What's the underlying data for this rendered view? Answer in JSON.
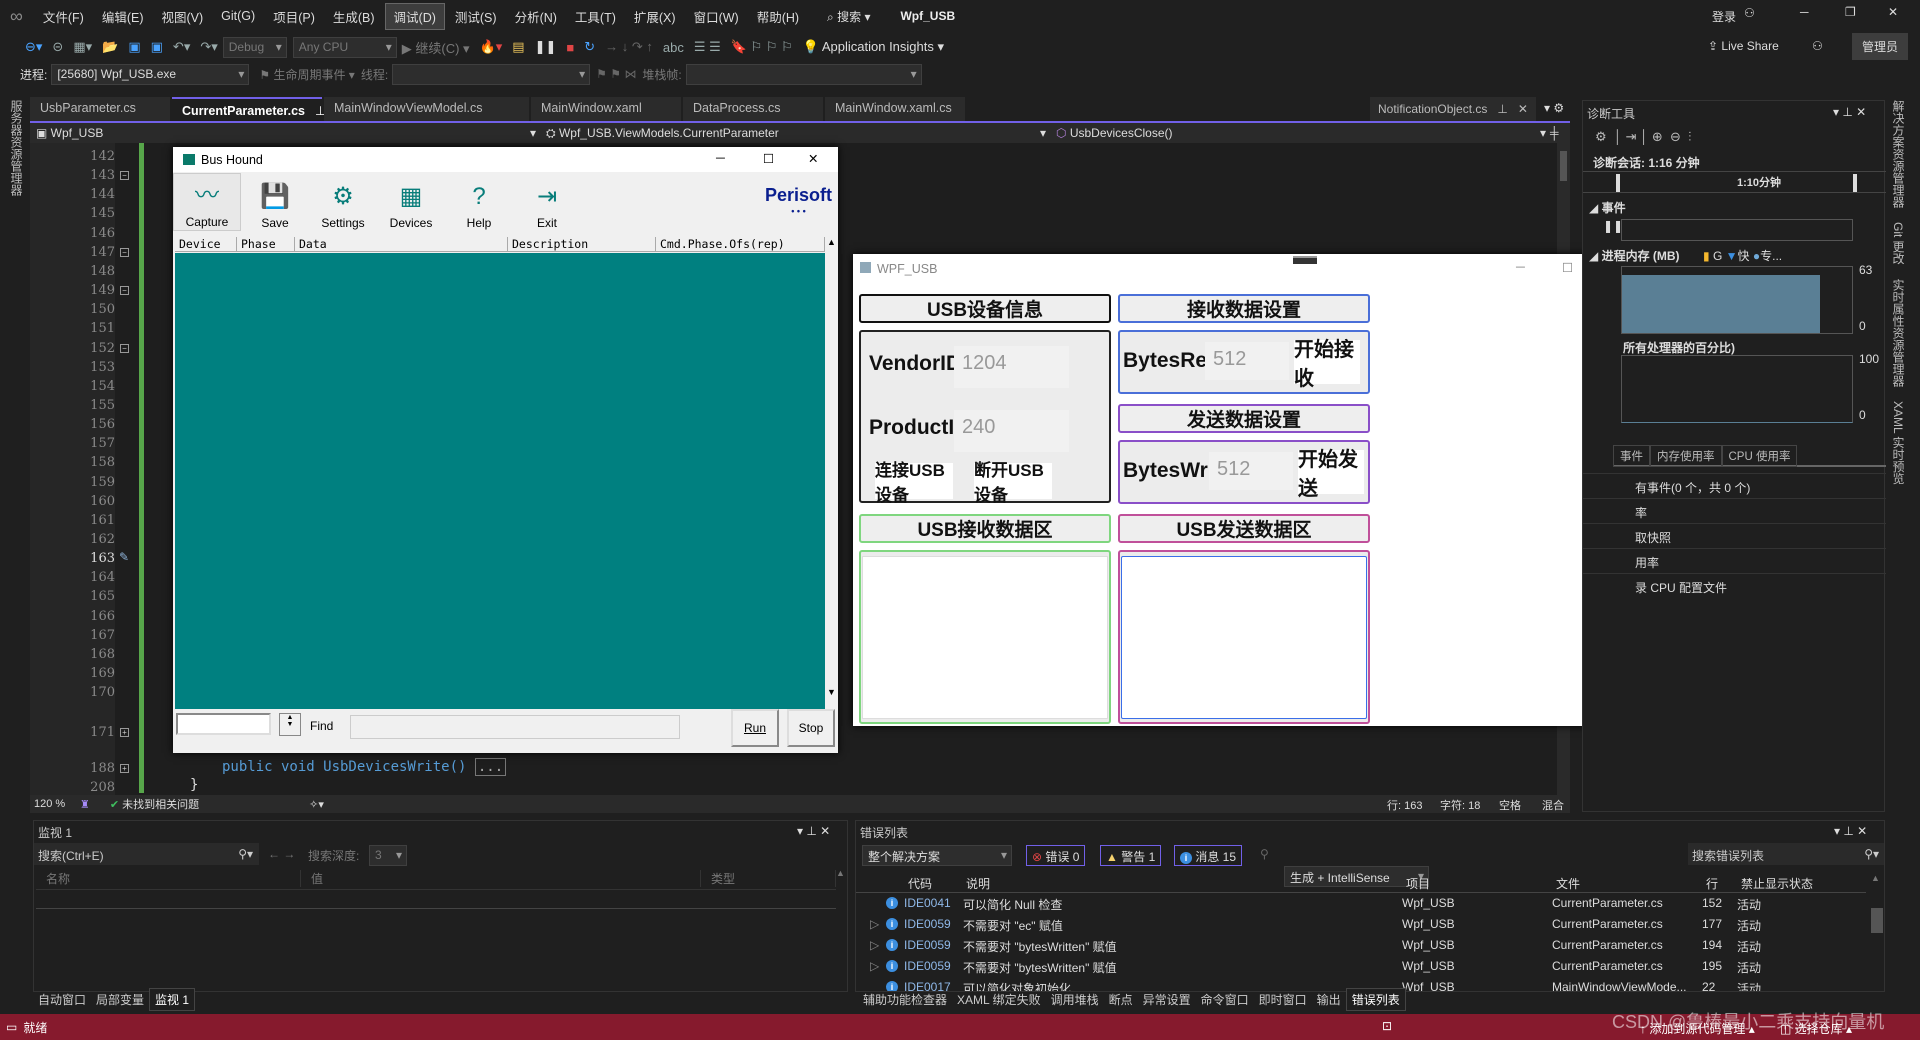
{
  "menubar": {
    "items": [
      "文件(F)",
      "编辑(E)",
      "视图(V)",
      "Git(G)",
      "项目(P)",
      "生成(B)",
      "调试(D)",
      "测试(S)",
      "分析(N)",
      "工具(T)",
      "扩展(X)",
      "窗口(W)",
      "帮助(H)"
    ],
    "active_index": 6,
    "search": "搜索",
    "solution_title": "Wpf_USB",
    "login": "登录"
  },
  "toolbar": {
    "config": "Debug",
    "platform": "Any CPU",
    "continue": "继续(C)",
    "app_insights": "Application Insights",
    "live_share": "Live Share",
    "admin": "管理员"
  },
  "toolbar2": {
    "process_label": "进程:",
    "process_value": "[25680] Wpf_USB.exe",
    "lifecycle": "生命周期事件",
    "thread_label": "线程:",
    "stackframe_label": "堆栈帧:"
  },
  "tabs": [
    "UsbParameter.cs",
    "CurrentParameter.cs",
    "MainWindowViewModel.cs",
    "MainWindow.xaml",
    "DataProcess.cs",
    "MainWindow.xaml.cs"
  ],
  "active_tab": 1,
  "pinned_tab": "NotificationObject.cs",
  "navbar": {
    "project": "Wpf_USB",
    "class": "Wpf_USB.ViewModels.CurrentParameter",
    "member": "UsbDevicesClose()"
  },
  "left_strip": "服务器资源管理器",
  "editor": {
    "line_numbers": [
      "142",
      "143",
      "144",
      "145",
      "146",
      "147",
      "148",
      "149",
      "150",
      "151",
      "152",
      "153",
      "154",
      "155",
      "156",
      "157",
      "158",
      "159",
      "160",
      "161",
      "162",
      "163",
      "164",
      "165",
      "166",
      "167",
      "168",
      "169",
      "170"
    ],
    "folded_lines": [
      "171",
      "188",
      "208"
    ],
    "current_line": "163",
    "code_line": "public void UsbDevicesWrite()",
    "collapsed": "...",
    "closing_brace": "}"
  },
  "editor_status": {
    "zoom": "120 %",
    "issues": "未找到相关问题",
    "line": "行: 163",
    "char": "字符: 18",
    "spaces": "空格",
    "eol": "混合"
  },
  "bushound": {
    "title": "Bus Hound",
    "tools": [
      "Capture",
      "Save",
      "Settings",
      "Devices",
      "Help",
      "Exit"
    ],
    "brand": "Perisoft",
    "columns": [
      "Device",
      "Phase",
      "Data",
      "Description",
      "Cmd.Phase.Ofs(rep)"
    ],
    "find_label": "Find",
    "run": "Run",
    "stop": "Stop",
    "capture_bg": "#008080"
  },
  "wpf": {
    "title": "WPF_USB",
    "device_header": "USB设备信息",
    "vendor_label": "VendorID:",
    "vendor_value": "1204",
    "product_label": "ProductID:",
    "product_value": "240",
    "connect": "连接USB设备",
    "disconnect": "断开USB设备",
    "recv_settings": "接收数据设置",
    "bytes_read_label": "BytesRead:",
    "bytes_read_value": "512",
    "start_recv": "开始接收",
    "send_settings": "发送数据设置",
    "bytes_write_label": "BytesWrite:",
    "bytes_write_value": "512",
    "start_send": "开始发送",
    "recv_area": "USB接收数据区",
    "send_area": "USB发送数据区",
    "colors": {
      "device": "#111111",
      "recv": "#4a6fd8",
      "send": "#8a4fc8",
      "recv_area": "#7fd67f",
      "send_area": "#c0509a"
    }
  },
  "diagnostics": {
    "title": "诊断工具",
    "session": "诊断会话: 1:16 分钟",
    "timeline_label": "1:10分钟",
    "events": "事件",
    "memory": "进程内存 (MB)",
    "legend": [
      "G",
      "快",
      "专..."
    ],
    "mem_max": "63",
    "mem_min": "0",
    "cpu_title": "所有处理器的百分比)",
    "cpu_max": "100",
    "cpu_min": "0",
    "tabs": [
      "事件",
      "内存使用率",
      "CPU 使用率"
    ],
    "rows": [
      "有事件(0 个，共 0 个)",
      "率",
      "取快照",
      "用率",
      "录 CPU 配置文件"
    ]
  },
  "right_strip": [
    "解决方案资源管理器",
    "Git 更改",
    "实时属性资源管理器",
    "XAML 实时预览"
  ],
  "watch": {
    "title": "监视 1",
    "search": "搜索(Ctrl+E)",
    "depth_label": "搜索深度:",
    "depth": "3",
    "columns": [
      "名称",
      "值",
      "类型"
    ],
    "tabs": [
      "自动窗口",
      "局部变量",
      "监视 1"
    ]
  },
  "errorlist": {
    "title": "错误列表",
    "scope": "整个解决方案",
    "errors": "错误 0",
    "warnings": "警告 1",
    "messages": "消息 15",
    "build": "生成 + IntelliSense",
    "search": "搜索错误列表",
    "columns": [
      "代码",
      "说明",
      "项目",
      "文件",
      "行",
      "禁止显示状态"
    ],
    "rows": [
      {
        "code": "IDE0041",
        "desc": "可以简化 Null 检查",
        "project": "Wpf_USB",
        "file": "CurrentParameter.cs",
        "line": "152",
        "state": "活动"
      },
      {
        "code": "IDE0059",
        "desc": "不需要对 \"ec\" 赋值",
        "project": "Wpf_USB",
        "file": "CurrentParameter.cs",
        "line": "177",
        "state": "活动"
      },
      {
        "code": "IDE0059",
        "desc": "不需要对 \"bytesWritten\" 赋值",
        "project": "Wpf_USB",
        "file": "CurrentParameter.cs",
        "line": "194",
        "state": "活动"
      },
      {
        "code": "IDE0059",
        "desc": "不需要对 \"bytesWritten\" 赋值",
        "project": "Wpf_USB",
        "file": "CurrentParameter.cs",
        "line": "195",
        "state": "活动"
      },
      {
        "code": "IDE0017",
        "desc": "可以简化对象初始化",
        "project": "Wpf_USB",
        "file": "MainWindowViewMode...",
        "line": "22",
        "state": "活动"
      }
    ]
  },
  "bottom_tabs": [
    "辅助功能检查器",
    "XAML 绑定失败",
    "调用堆栈",
    "断点",
    "异常设置",
    "命令窗口",
    "即时窗口",
    "输出",
    "错误列表"
  ],
  "statusbar": {
    "ready": "就绪",
    "add_source": "添加到源代码管理",
    "select_repo": "选择仓库",
    "watermark": "CSDN @鲁棒最小二乘支持向量机",
    "color": "#861a2d"
  }
}
